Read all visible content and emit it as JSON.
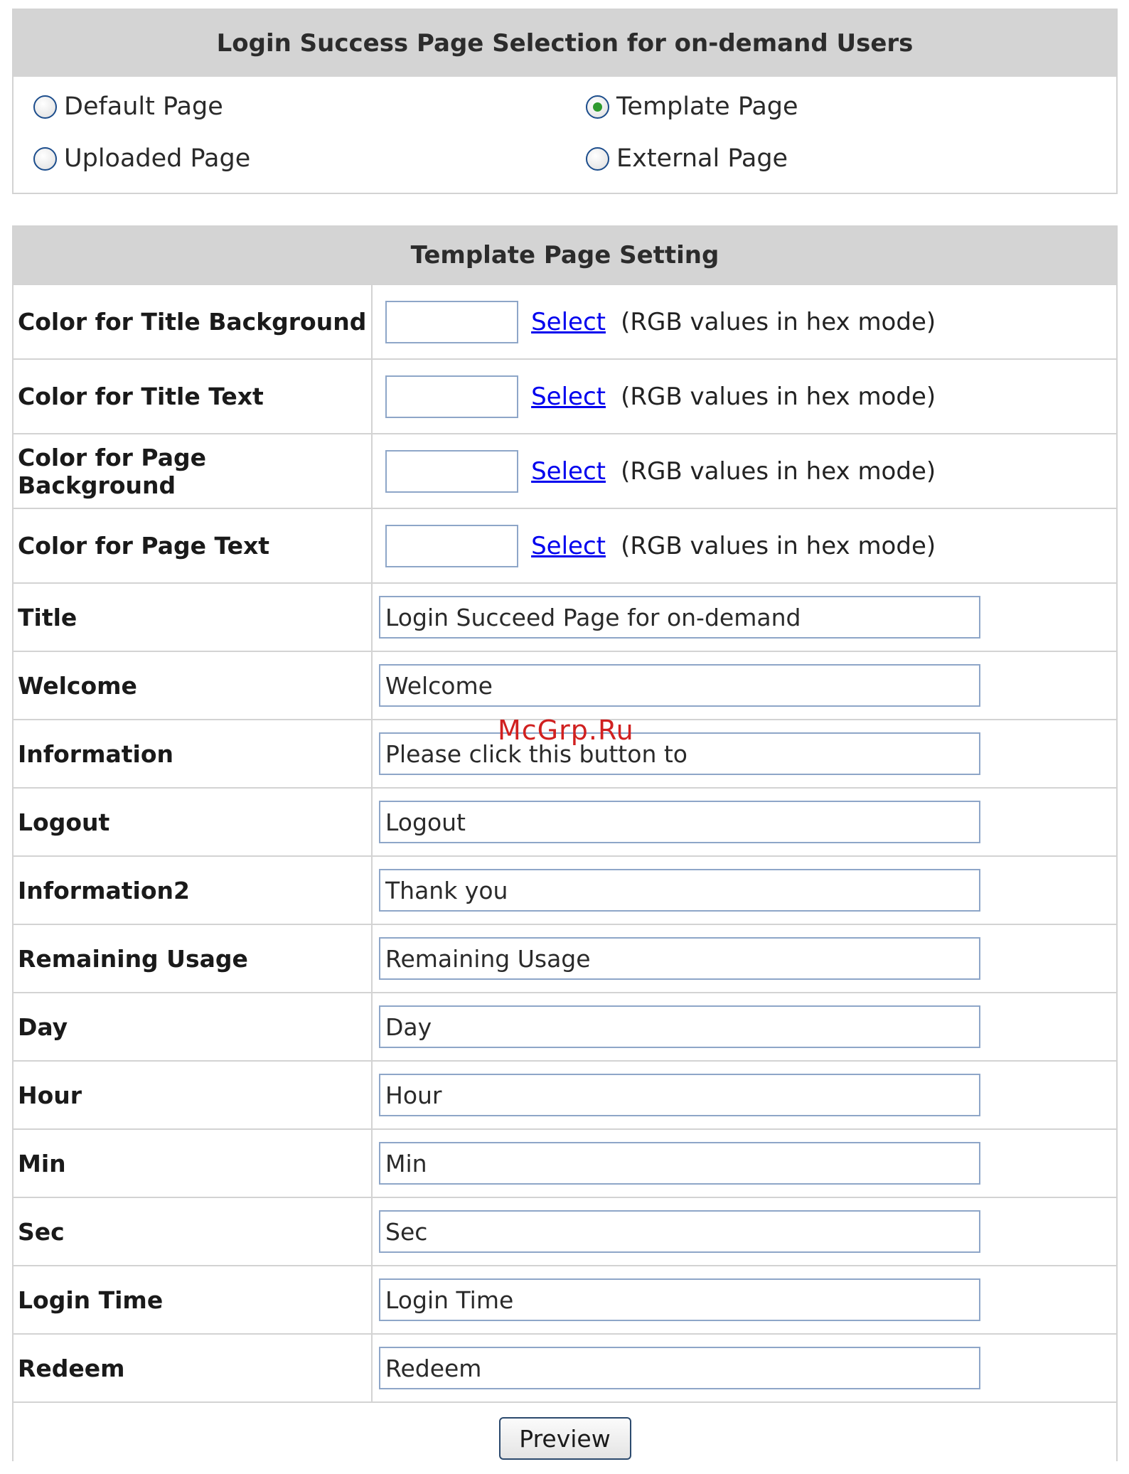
{
  "selection": {
    "title": "Login Success Page Selection for on-demand Users",
    "options": [
      {
        "label": "Default Page",
        "checked": false
      },
      {
        "label": "Template Page",
        "checked": true
      },
      {
        "label": "Uploaded Page",
        "checked": false
      },
      {
        "label": "External Page",
        "checked": false
      }
    ]
  },
  "template": {
    "title": "Template Page Setting",
    "color_rows": [
      {
        "label": "Color for Title Background",
        "value": "",
        "link": "Select",
        "hint": "(RGB values in hex mode)"
      },
      {
        "label": "Color for Title Text",
        "value": "",
        "link": "Select",
        "hint": "(RGB values in hex mode)"
      },
      {
        "label": "Color for Page Background",
        "value": "",
        "link": "Select",
        "hint": "(RGB values in hex mode)"
      },
      {
        "label": "Color for Page Text",
        "value": "",
        "link": "Select",
        "hint": "(RGB values in hex mode)"
      }
    ],
    "text_rows": [
      {
        "label": "Title",
        "value": "Login Succeed Page for on-demand"
      },
      {
        "label": "Welcome",
        "value": "Welcome"
      },
      {
        "label": "Information",
        "value": "Please click this button to"
      },
      {
        "label": "Logout",
        "value": "Logout"
      },
      {
        "label": "Information2",
        "value": "Thank you"
      },
      {
        "label": "Remaining Usage",
        "value": "Remaining Usage"
      },
      {
        "label": "Day",
        "value": "Day"
      },
      {
        "label": "Hour",
        "value": "Hour"
      },
      {
        "label": "Min",
        "value": "Min"
      },
      {
        "label": "Sec",
        "value": "Sec"
      },
      {
        "label": "Login Time",
        "value": "Login Time"
      },
      {
        "label": "Redeem",
        "value": "Redeem"
      }
    ],
    "preview_label": "Preview"
  },
  "watermark": "McGrp.Ru",
  "colors": {
    "header_bg": "#d4d4d4",
    "border": "#d3d3d3",
    "link": "#0000ee",
    "input_border": "#8ea6c8"
  }
}
